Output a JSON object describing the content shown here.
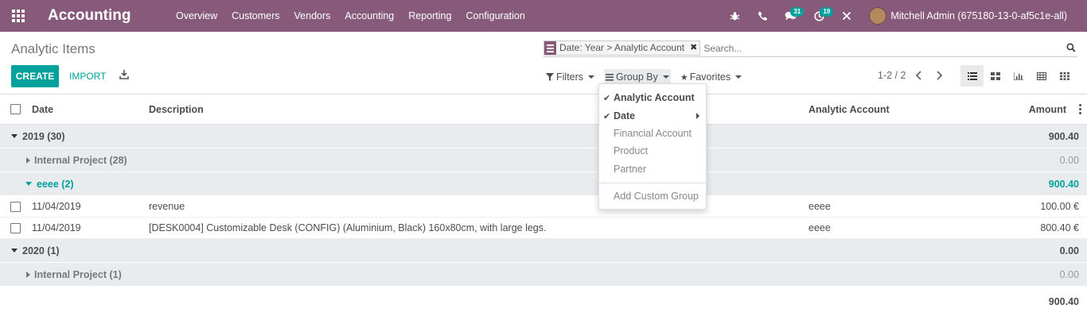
{
  "navbar": {
    "app_title": "Accounting",
    "menu": [
      "Overview",
      "Customers",
      "Vendors",
      "Accounting",
      "Reporting",
      "Configuration"
    ],
    "messages_count": "31",
    "activities_count": "19",
    "user_name": "Mitchell Admin (675180-13-0-af5c1e-all)"
  },
  "control_panel": {
    "breadcrumb": "Analytic Items",
    "facet_value": "Date: Year > Analytic Account",
    "search_placeholder": "Search...",
    "create_label": "CREATE",
    "import_label": "IMPORT",
    "filters_label": "Filters",
    "groupby_label": "Group By",
    "favorites_label": "Favorites",
    "pager": "1-2 / 2"
  },
  "groupby_menu": {
    "items": [
      {
        "label": "Analytic Account",
        "checked": true
      },
      {
        "label": "Date",
        "checked": true
      },
      {
        "label": "Financial Account",
        "checked": false
      },
      {
        "label": "Product",
        "checked": false
      },
      {
        "label": "Partner",
        "checked": false
      }
    ],
    "custom_label": "Add Custom Group"
  },
  "table": {
    "headers": {
      "date": "Date",
      "description": "Description",
      "account": "Analytic Account",
      "amount": "Amount"
    },
    "groups": [
      {
        "label": "2019 (30)",
        "amount": "900.40"
      },
      {
        "label": "Internal Project (28)",
        "amount": "0.00"
      },
      {
        "label": "eeee (2)",
        "amount": "900.40"
      },
      {
        "label": "2020 (1)",
        "amount": "0.00"
      },
      {
        "label": "Internal Project (1)",
        "amount": "0.00"
      }
    ],
    "rows": [
      {
        "date": "11/04/2019",
        "description": "revenue",
        "account": "eeee",
        "amount": "100.00 €"
      },
      {
        "date": "11/04/2019",
        "description": "[DESK0004] Customizable Desk (CONFIG) (Aluminium, Black) 160x80cm, with large legs.",
        "account": "eeee",
        "amount": "800.40 €"
      }
    ],
    "total": "900.40"
  }
}
